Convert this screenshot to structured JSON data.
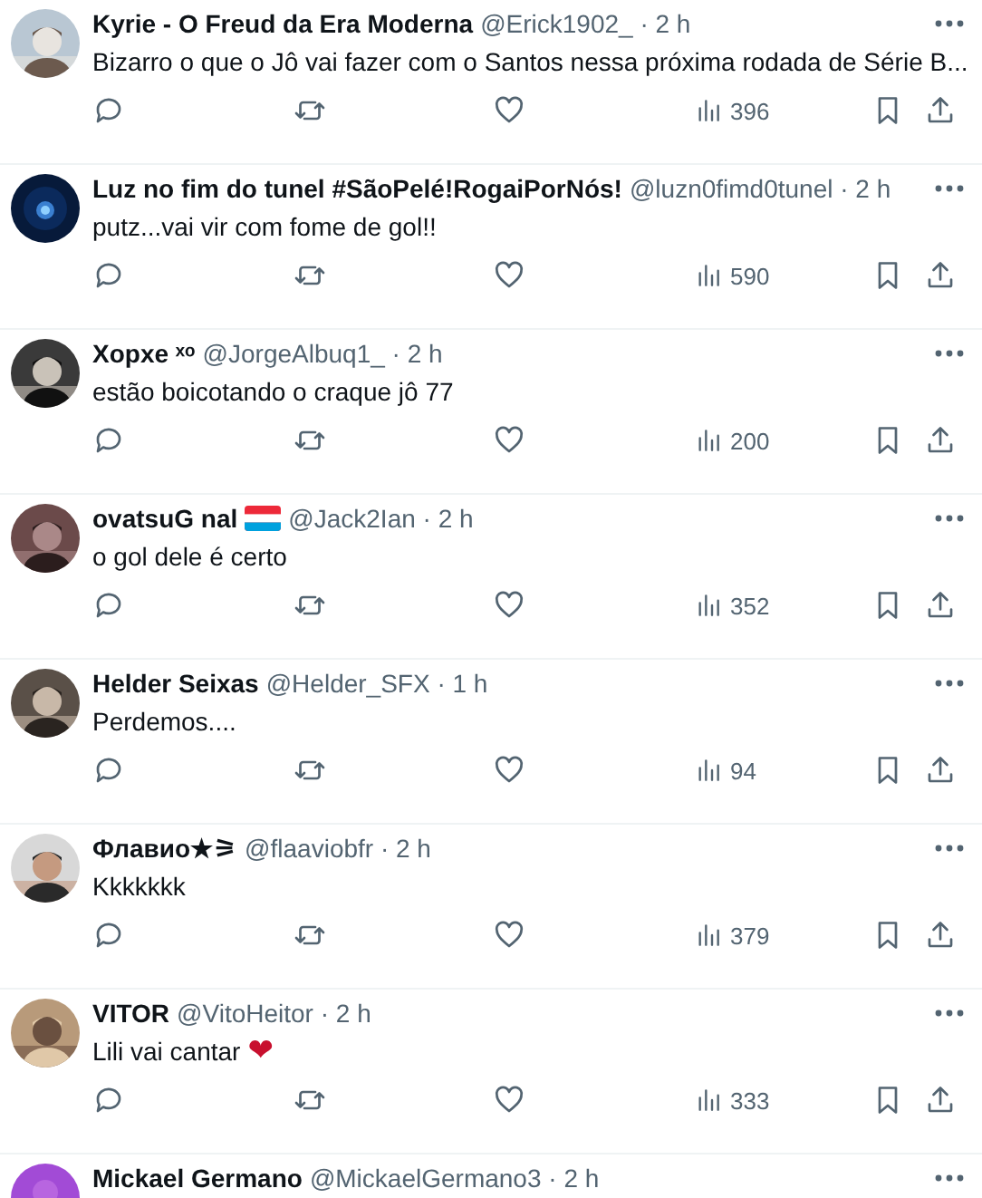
{
  "replies": [
    {
      "name": "Kyrie - O Freud da Era Moderna",
      "meta": "@Erick1902_ · 2 h",
      "text": "Bizarro o que o Jô vai fazer com o Santos nessa próxima rodada de Série B...",
      "views": "396"
    },
    {
      "name": "Luz no fim do tunel #SãoPelé!RogaiPorNós!",
      "meta": "@luzn0fimd0tunel · 2 h",
      "text": "putz...vai vir com fome de gol!!",
      "views": "590"
    },
    {
      "name": "Xopxe ˣᵒ",
      "meta": "@JorgeAlbuq1_ · 2 h",
      "text": "estão boicotando o craque jô 77",
      "views": "200"
    },
    {
      "name": "ovatsuG nal",
      "flag": true,
      "meta": "@Jack2Ian · 2 h",
      "text": "o gol dele é certo",
      "views": "352"
    },
    {
      "name": "Helder Seixas",
      "meta": "@Helder_SFX · 1 h",
      "text": "Perdemos....",
      "views": "94"
    },
    {
      "name": "Флавио★⚞",
      "meta": "@flaaviobfr · 2 h",
      "text": "Kkkkkkk",
      "views": "379"
    },
    {
      "name": "VITOR",
      "meta": "@VitoHeitor · 2 h",
      "text": "Lili vai cantar",
      "emoji": "❤",
      "views": "333"
    },
    {
      "name": "Mickael Germano",
      "meta": "@MickaelGermano3 · 2 h"
    }
  ]
}
